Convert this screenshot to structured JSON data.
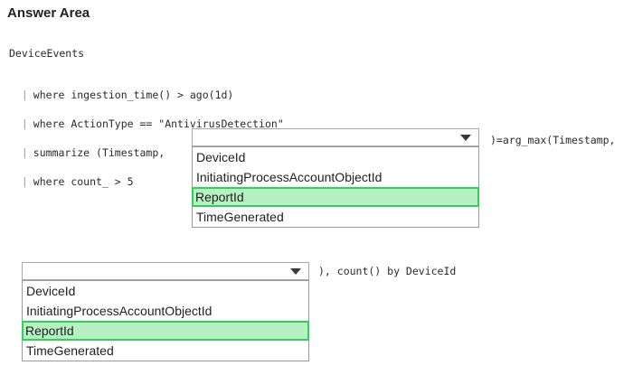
{
  "title": "Answer Area",
  "code": {
    "line1": "DeviceEvents",
    "line2": "where ingestion_time() > ago(1d)",
    "line3": "where ActionType == \"AntivirusDetection\"",
    "line4_prefix": "summarize (Timestamp,",
    "line4_suffix": ")=arg_max(Timestamp,",
    "line5": "where count_ > 5",
    "line6_suffix": "), count() by DeviceId",
    "pipe": "|"
  },
  "dropdown1": {
    "options": [
      "DeviceId",
      "InitiatingProcessAccountObjectId",
      "ReportId",
      "TimeGenerated"
    ],
    "selected": "ReportId"
  },
  "dropdown2": {
    "options": [
      "DeviceId",
      "InitiatingProcessAccountObjectId",
      "ReportId",
      "TimeGenerated"
    ],
    "selected": "ReportId"
  }
}
